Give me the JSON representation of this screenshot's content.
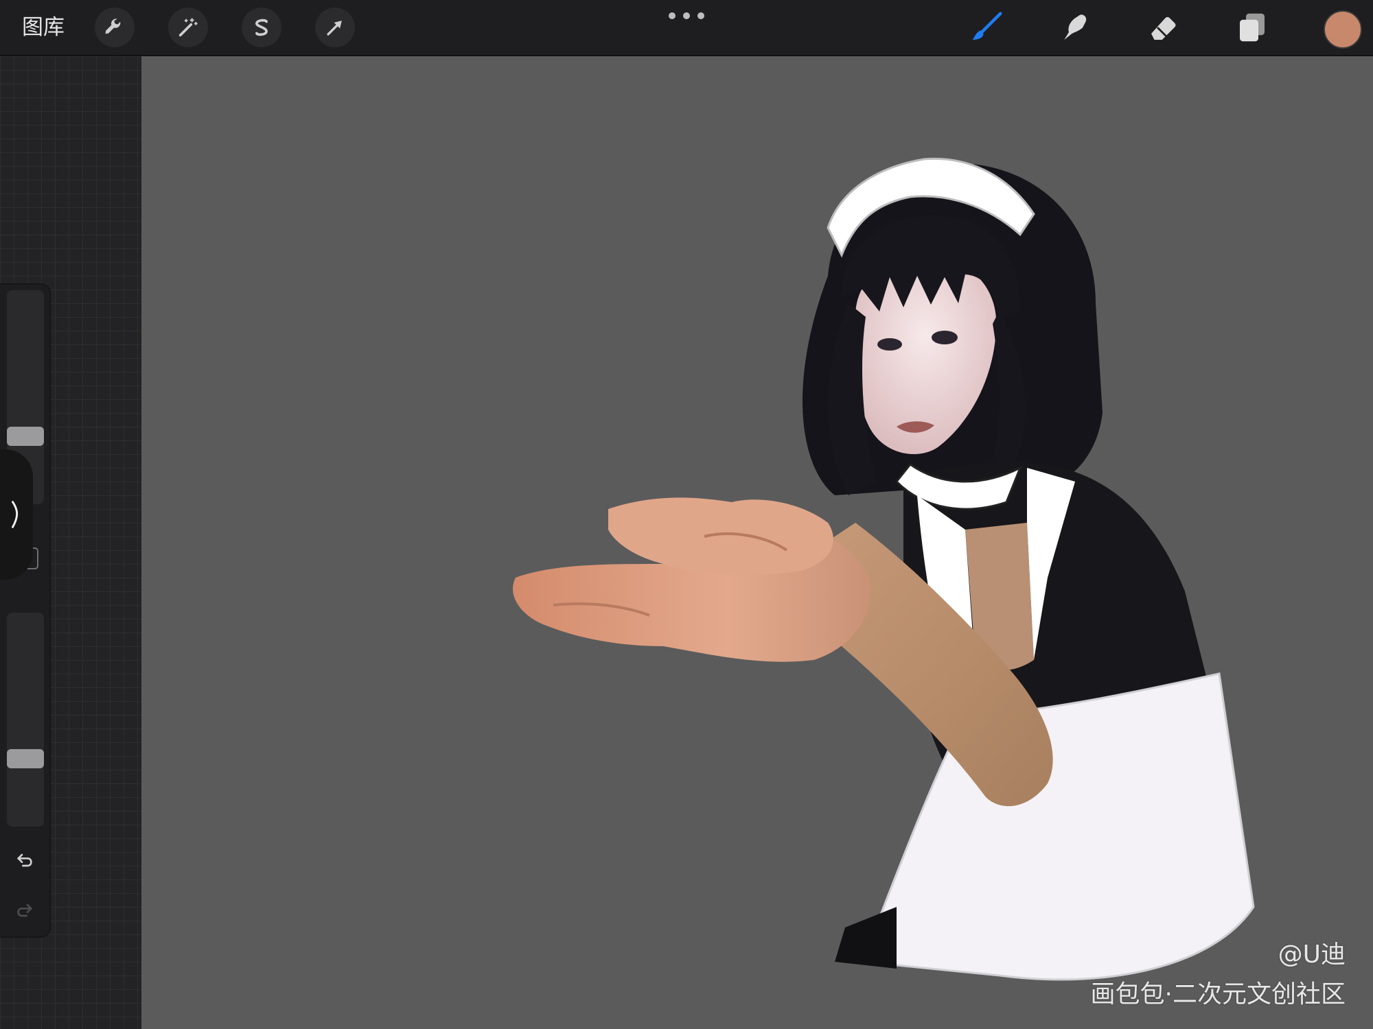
{
  "toolbar": {
    "gallery_label": "图库",
    "left_tools": [
      {
        "name": "actions",
        "icon": "wrench-icon"
      },
      {
        "name": "adjustments",
        "icon": "magic-wand-icon"
      },
      {
        "name": "selection",
        "icon": "selection-s-icon"
      },
      {
        "name": "transform",
        "icon": "arrow-cursor-icon"
      }
    ],
    "more_icon": "more-dots-icon",
    "right_tools": [
      {
        "name": "brush",
        "icon": "brush-icon",
        "active": true,
        "color": "#1f7cf2"
      },
      {
        "name": "smudge",
        "icon": "smudge-finger-icon",
        "active": false
      },
      {
        "name": "eraser",
        "icon": "eraser-icon",
        "active": false
      },
      {
        "name": "layers",
        "icon": "layers-icon",
        "active": false
      }
    ],
    "current_color": "#c8886b"
  },
  "sidebar": {
    "brush_size_level": 0.3,
    "opacity_level": 0.3,
    "toggle_icon": "chevron-right-icon",
    "modify_icon": "square-icon",
    "undo_icon": "undo-icon",
    "redo_icon": "redo-icon"
  },
  "canvas": {
    "background": "#5b5b5b",
    "watermark_author": "@U迪",
    "watermark_source": "画包包·二次元文创社区"
  }
}
